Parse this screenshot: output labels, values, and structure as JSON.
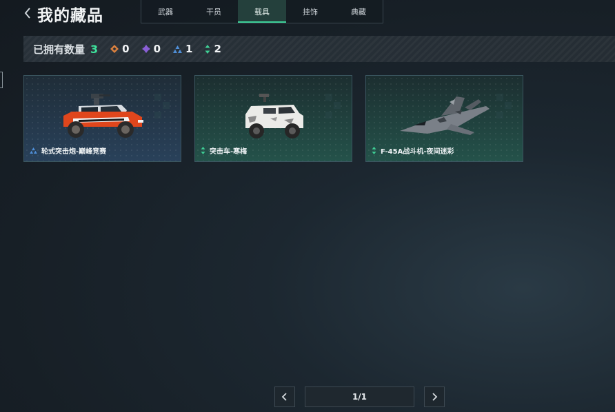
{
  "header": {
    "title": "我的藏品"
  },
  "tabs": [
    {
      "label": "武器",
      "active": false
    },
    {
      "label": "干员",
      "active": false
    },
    {
      "label": "载具",
      "active": true
    },
    {
      "label": "挂饰",
      "active": false
    },
    {
      "label": "典藏",
      "active": false
    }
  ],
  "stats": {
    "owned_label": "已拥有数量",
    "owned_total": "3",
    "rarity_counts": [
      {
        "icon": "orange-diamond-icon",
        "color": "#d9803f",
        "value": "0"
      },
      {
        "icon": "purple-diamond-icon",
        "color": "#8a5fd6",
        "value": "0"
      },
      {
        "icon": "blue-triangle-icon",
        "color": "#4f8fd8",
        "value": "1"
      },
      {
        "icon": "green-arrows-icon",
        "color": "#3fcf95",
        "value": "2"
      }
    ]
  },
  "items": [
    {
      "name": "轮式突击炮-巅峰竞赛",
      "rarity_icon": "blue-triangle-icon",
      "rarity_color": "#4f8fd8",
      "image": "orange-assault-vehicle"
    },
    {
      "name": "突击车-寒梅",
      "rarity_icon": "green-arrows-icon",
      "rarity_color": "#3fcf95",
      "image": "white-armored-car"
    },
    {
      "name": "F-45A战斗机-夜间迷彩",
      "rarity_icon": "green-arrows-icon",
      "rarity_color": "#3fcf95",
      "image": "camo-fighter-jet"
    }
  ],
  "pagination": {
    "indicator": "1/1"
  },
  "colors": {
    "accent": "#3ed29a",
    "background": "#1c2730"
  }
}
